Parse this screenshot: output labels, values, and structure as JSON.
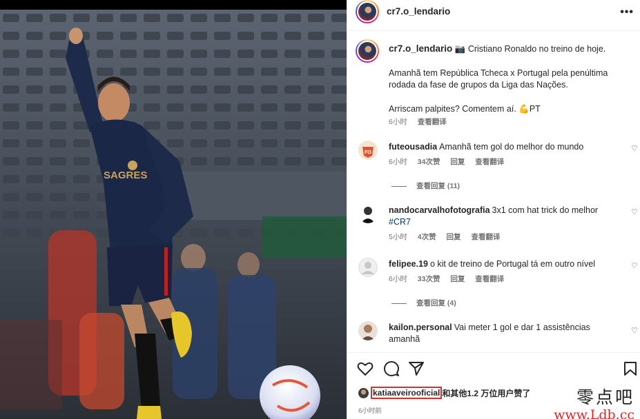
{
  "post": {
    "username": "cr7.o_lendario",
    "more_label": "•••",
    "caption": {
      "line1": "📷 Cristiano Ronaldo no treino de hoje.",
      "line2": "Amanhã tem República Tcheca x Portugal pela penúltima rodada da fase de grupos da Liga das Nações.",
      "line3": "Arriscam palpites? Comentem aí. 💪PT",
      "time": "6小时",
      "translate": "查看翻译"
    }
  },
  "comments": [
    {
      "user": "futeousadia",
      "text": "Amanhã tem gol do melhor do mundo",
      "time": "6小时",
      "likes": "34次赞",
      "reply": "回复",
      "translate": "查看翻译",
      "view_replies": "查看回复 (11)"
    },
    {
      "user": "nandocarvalhofotografia",
      "text": "3x1 com hat trick do melhor",
      "hashtag": "#CR7",
      "time": "5小时",
      "likes": "4次赞",
      "reply": "回复",
      "translate": "查看翻译"
    },
    {
      "user": "felipee.19",
      "text": "o kit de treino de Portugal tá em outro nível",
      "time": "6小时",
      "likes": "33次赞",
      "reply": "回复",
      "translate": "查看翻译",
      "view_replies": "查看回复 (4)"
    },
    {
      "user": "kailon.personal",
      "text": "Vai meter 1 gol e dar 1 assistências amanhã"
    }
  ],
  "likes_bar": {
    "liker": "katiaaveirooficial",
    "rest": "和其他1.2 万位用户赞了",
    "time_ago": "6小时前"
  },
  "photo": {
    "shirt_text": "SAGRES"
  },
  "watermark": {
    "cn": "零点吧",
    "url": "www.Ldb.cc"
  },
  "icons": [
    "more-icon",
    "heart-icon",
    "comment-icon",
    "share-icon",
    "bookmark-icon"
  ],
  "colors": {
    "link": "#00376b",
    "muted": "#737373",
    "highlight_box": "#d62c2c",
    "watermark_url": "#e02424"
  }
}
